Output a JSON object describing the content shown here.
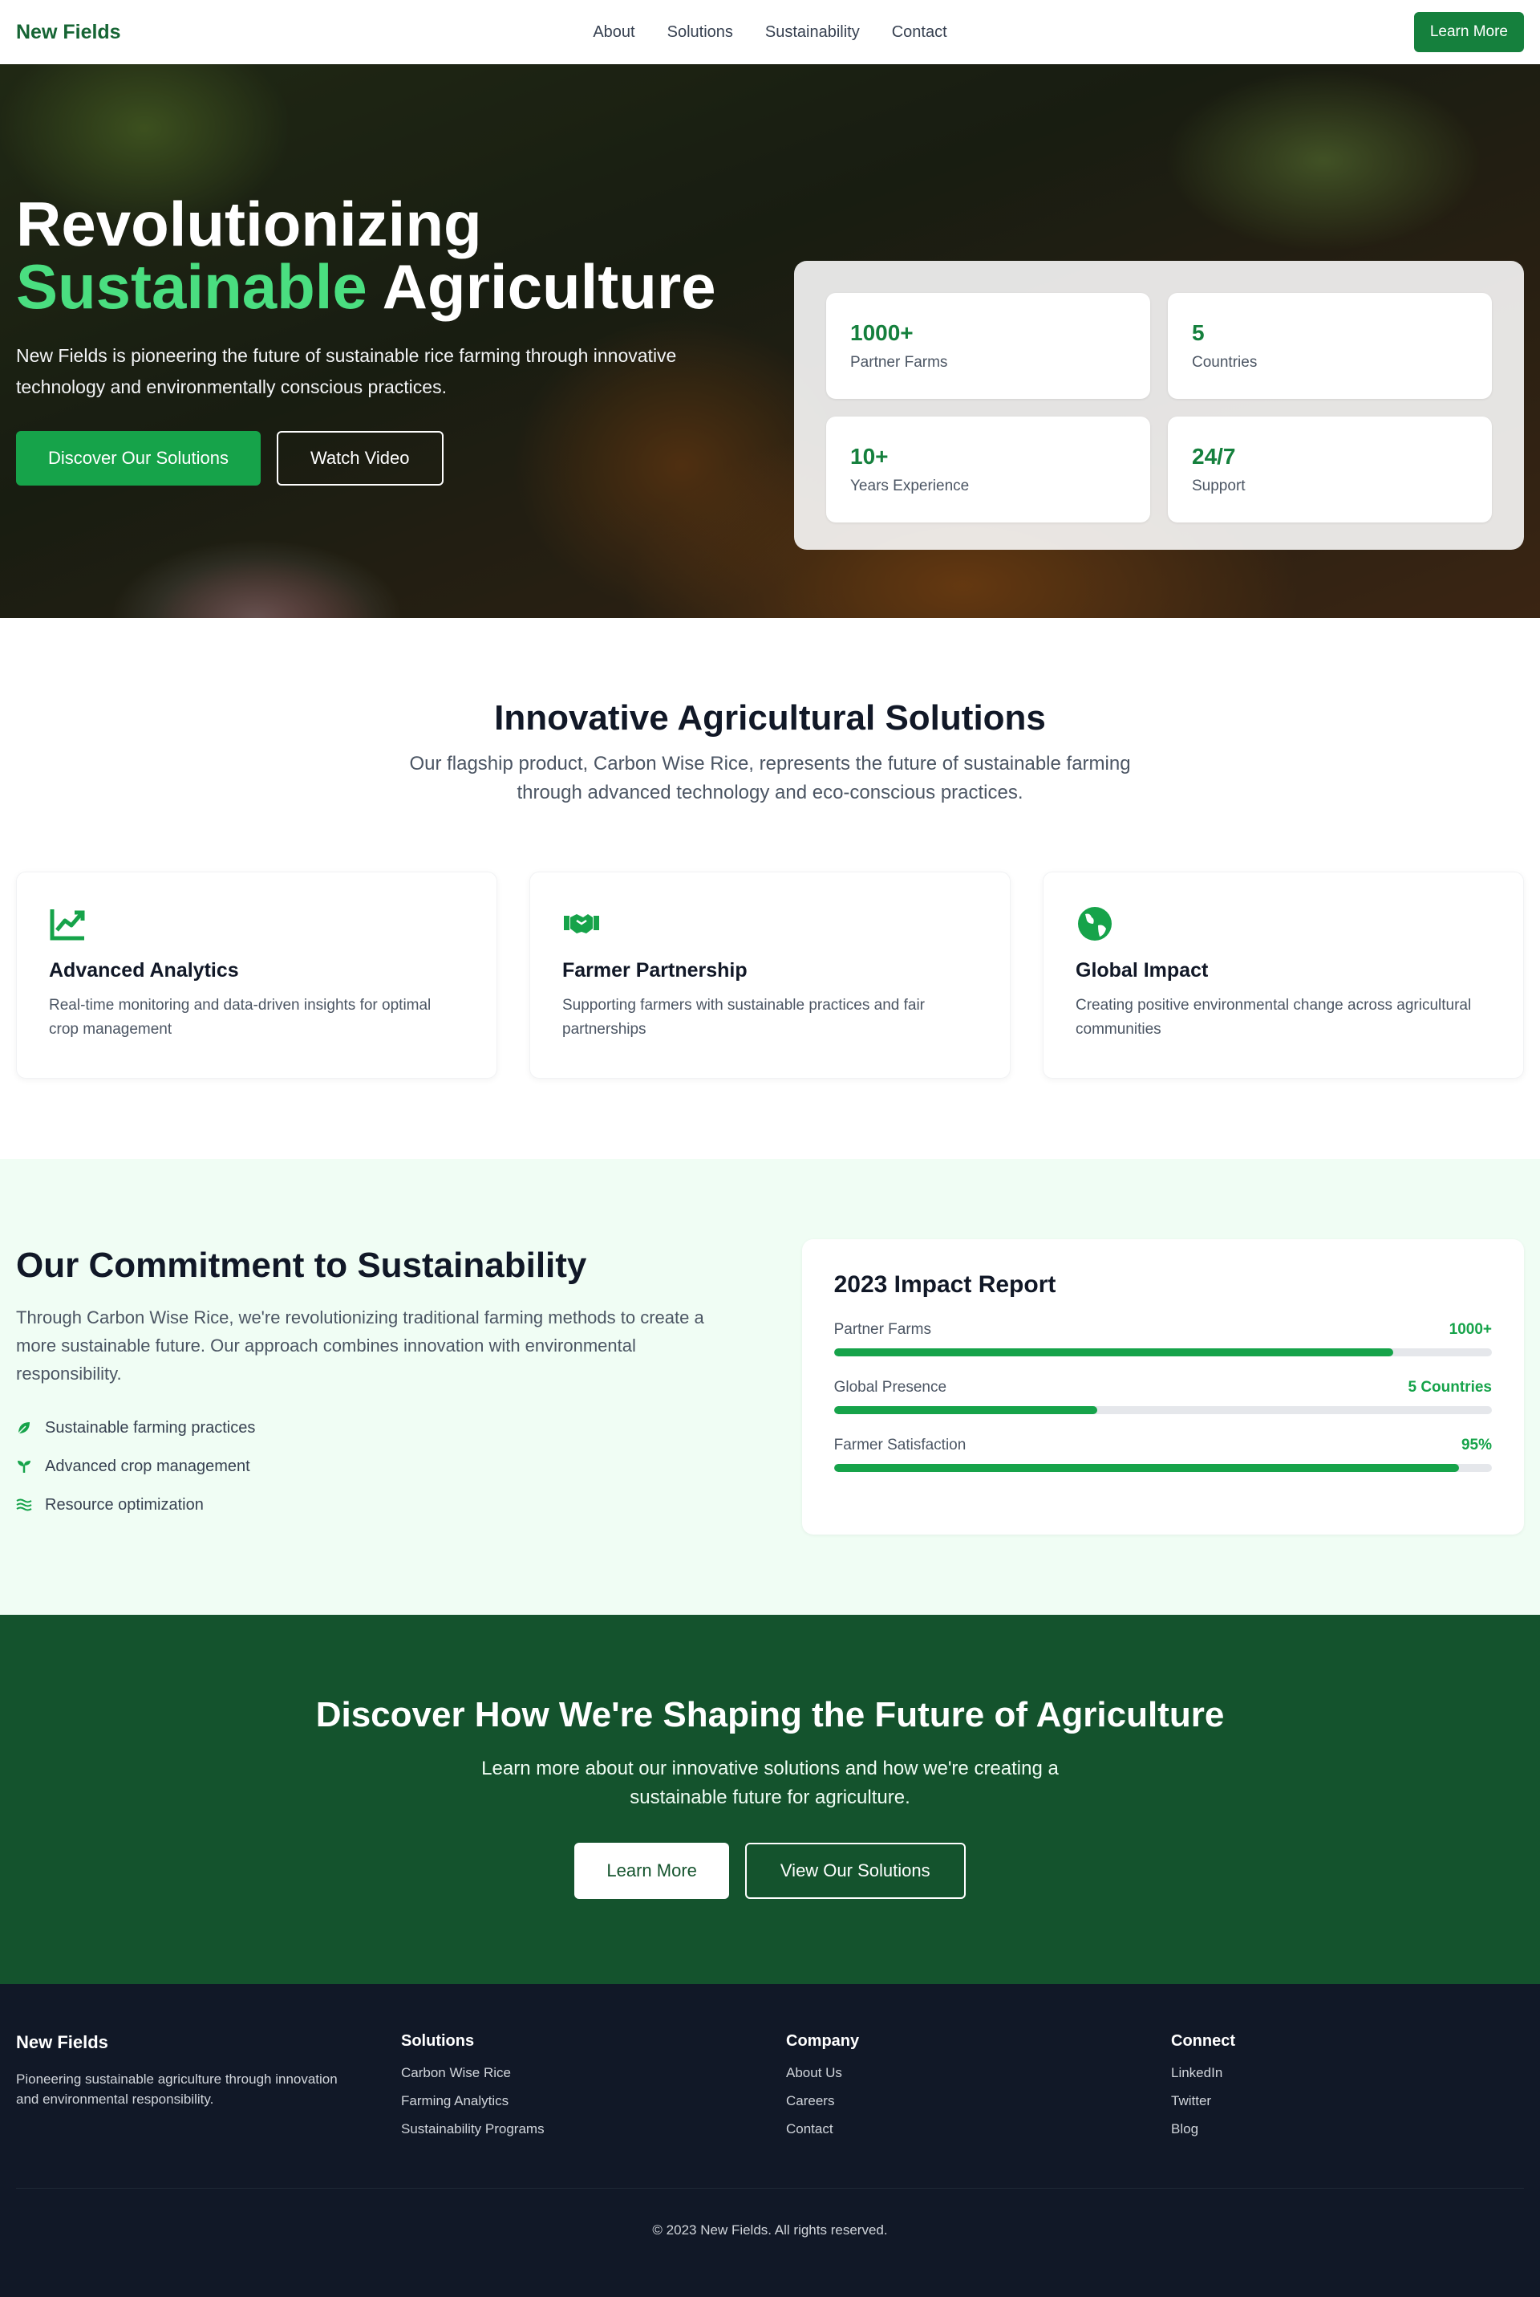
{
  "nav": {
    "brand": "New Fields",
    "links": [
      "About",
      "Solutions",
      "Sustainability",
      "Contact"
    ],
    "cta_label": "Learn More"
  },
  "hero": {
    "title_line1": "Revolutionizing",
    "title_accent": "Sustainable",
    "title_rest": " Agriculture",
    "subtitle": "New Fields is pioneering the future of sustainable rice farming through innovative technology and environmentally conscious practices.",
    "primary_button": "Discover Our Solutions",
    "secondary_button": "Watch Video",
    "stats": [
      {
        "value": "1000+",
        "label": "Partner Farms"
      },
      {
        "value": "5",
        "label": "Countries"
      },
      {
        "value": "10+",
        "label": "Years Experience"
      },
      {
        "value": "24/7",
        "label": "Support"
      }
    ]
  },
  "solutions": {
    "title": "Innovative Agricultural Solutions",
    "subtitle": "Our flagship product, Carbon Wise Rice, represents the future of sustainable farming through advanced technology and eco-conscious practices.",
    "features": [
      {
        "icon": "chart-line-icon",
        "title": "Advanced Analytics",
        "description": "Real-time monitoring and data-driven insights for optimal crop management"
      },
      {
        "icon": "handshake-icon",
        "title": "Farmer Partnership",
        "description": "Supporting farmers with sustainable practices and fair partnerships"
      },
      {
        "icon": "globe-icon",
        "title": "Global Impact",
        "description": "Creating positive environmental change across agricultural communities"
      }
    ]
  },
  "commitment": {
    "title": "Our Commitment to Sustainability",
    "text": "Through Carbon Wise Rice, we're revolutionizing traditional farming methods to create a more sustainable future. Our approach combines innovation with environmental responsibility.",
    "items": [
      {
        "icon": "leaf-icon",
        "label": "Sustainable farming practices"
      },
      {
        "icon": "seedling-icon",
        "label": "Advanced crop management"
      },
      {
        "icon": "water-icon",
        "label": "Resource optimization"
      }
    ],
    "report": {
      "title": "2023 Impact Report",
      "metrics": [
        {
          "label": "Partner Farms",
          "value": "1000+",
          "progress": 85
        },
        {
          "label": "Global Presence",
          "value": "5 Countries",
          "progress": 40
        },
        {
          "label": "Farmer Satisfaction",
          "value": "95%",
          "progress": 95
        }
      ]
    }
  },
  "cta": {
    "title": "Discover How We're Shaping the Future of Agriculture",
    "subtitle": "Learn more about our innovative solutions and how we're creating a sustainable future for agriculture.",
    "primary_button": "Learn More",
    "secondary_button": "View Our Solutions"
  },
  "footer": {
    "brand": "New Fields",
    "description": "Pioneering sustainable agriculture through innovation and environmental responsibility.",
    "columns": [
      {
        "heading": "Solutions",
        "links": [
          "Carbon Wise Rice",
          "Farming Analytics",
          "Sustainability Programs"
        ]
      },
      {
        "heading": "Company",
        "links": [
          "About Us",
          "Careers",
          "Contact"
        ]
      },
      {
        "heading": "Connect",
        "links": [
          "LinkedIn",
          "Twitter",
          "Blog"
        ]
      }
    ],
    "copyright": "© 2023 New Fields. All rights reserved."
  },
  "colors": {
    "brand_green": "#15803d",
    "accent_green": "#4ade80",
    "cta_bg": "#14532d",
    "footer_bg": "#111827",
    "commitment_bg": "#f0fdf4"
  }
}
